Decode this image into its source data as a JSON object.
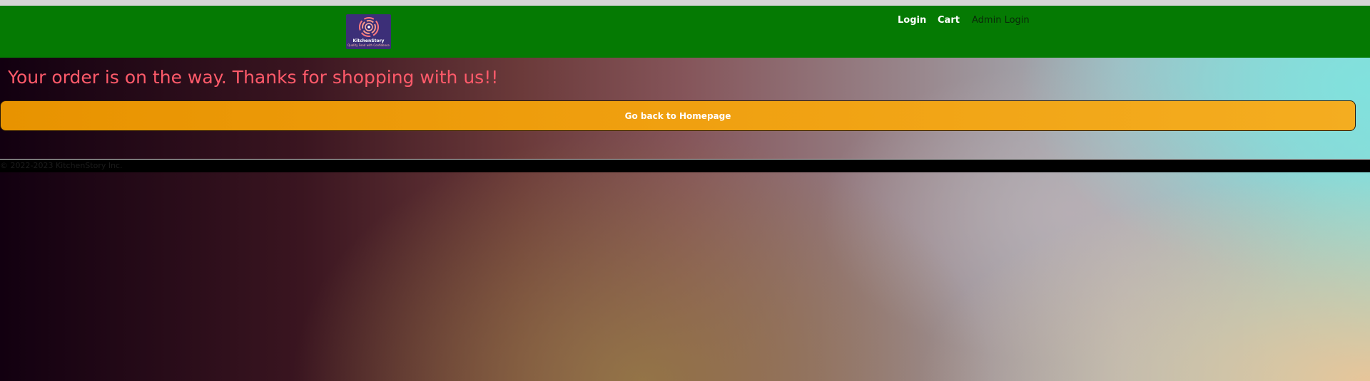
{
  "navbar": {
    "logo": {
      "name": "KitchenStory",
      "tagline": "Quality Food with Confidence"
    },
    "links": {
      "login": "Login",
      "cart": "Cart",
      "admin_login": "Admin Login"
    }
  },
  "main": {
    "headline": "Your order is on the way. Thanks for shopping with us!!",
    "home_button_label": "Go back to Homepage"
  },
  "footer": {
    "copyright": "© 2022-2023 KitchenStory Inc."
  },
  "colors": {
    "navbar_bg": "#057a03",
    "headline": "#ff5a6a",
    "button_bg": "#f0a010",
    "logo_bg": "#3c2f78"
  }
}
